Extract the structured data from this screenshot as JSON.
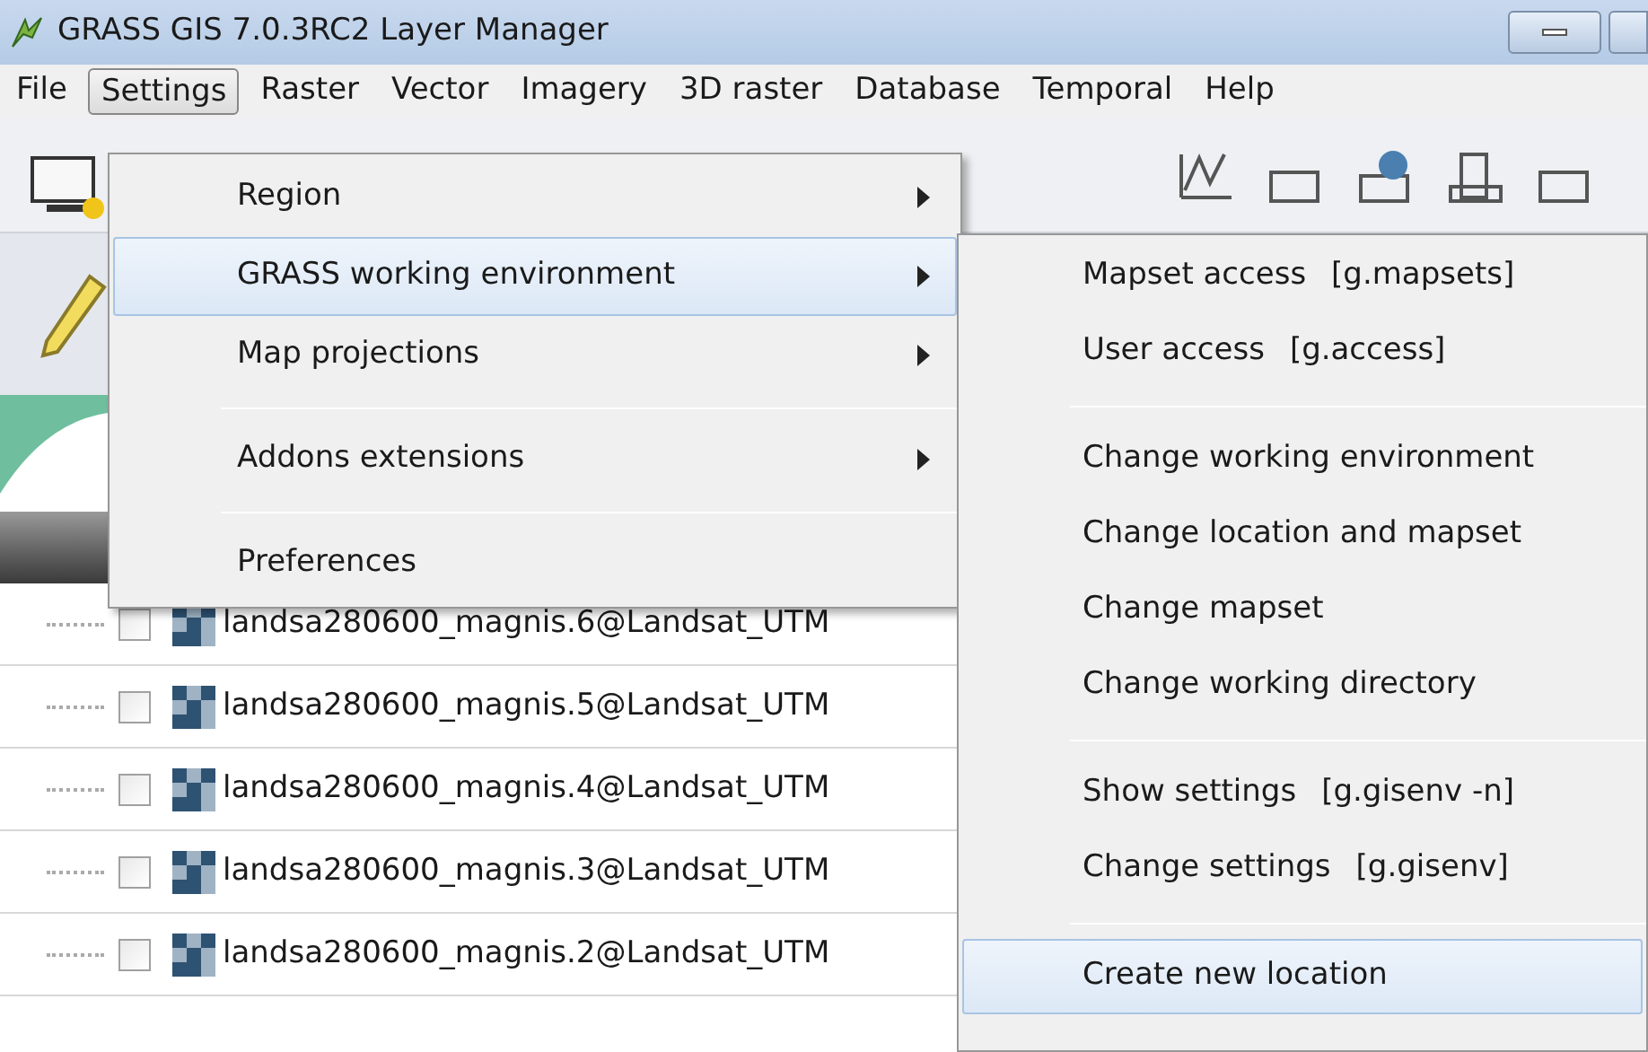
{
  "window": {
    "title": "GRASS GIS 7.0.3RC2 Layer Manager"
  },
  "menubar": [
    {
      "label": "File",
      "selected": false
    },
    {
      "label": "Settings",
      "selected": true
    },
    {
      "label": "Raster",
      "selected": false
    },
    {
      "label": "Vector",
      "selected": false
    },
    {
      "label": "Imagery",
      "selected": false
    },
    {
      "label": "3D raster",
      "selected": false
    },
    {
      "label": "Database",
      "selected": false
    },
    {
      "label": "Temporal",
      "selected": false
    },
    {
      "label": "Help",
      "selected": false
    }
  ],
  "settings_menu": [
    {
      "kind": "item",
      "label": "Region",
      "submenu": true,
      "selected": false
    },
    {
      "kind": "item",
      "label": "GRASS working environment",
      "submenu": true,
      "selected": true
    },
    {
      "kind": "item",
      "label": "Map projections",
      "submenu": true,
      "selected": false
    },
    {
      "kind": "separator"
    },
    {
      "kind": "item",
      "label": "Addons extensions",
      "submenu": true,
      "selected": false
    },
    {
      "kind": "separator"
    },
    {
      "kind": "item",
      "label": "Preferences",
      "submenu": false,
      "selected": false
    }
  ],
  "submenu": [
    {
      "kind": "item",
      "label": "Mapset access",
      "command": "[g.mapsets]",
      "selected": false
    },
    {
      "kind": "item",
      "label": "User access",
      "command": "[g.access]",
      "selected": false
    },
    {
      "kind": "separator"
    },
    {
      "kind": "item",
      "label": "Change working environment",
      "selected": false
    },
    {
      "kind": "item",
      "label": "Change location and mapset",
      "selected": false
    },
    {
      "kind": "item",
      "label": "Change mapset",
      "selected": false
    },
    {
      "kind": "item",
      "label": "Change working directory",
      "selected": false
    },
    {
      "kind": "separator"
    },
    {
      "kind": "item",
      "label": "Show settings",
      "command": "[g.gisenv -n]",
      "selected": false
    },
    {
      "kind": "item",
      "label": "Change settings",
      "command": "[g.gisenv]",
      "selected": false
    },
    {
      "kind": "separator"
    },
    {
      "kind": "item",
      "label": "Create new location",
      "selected": true
    }
  ],
  "layers": [
    {
      "name": "landsa280600_magnis.6@Landsat_UTM",
      "checked": false
    },
    {
      "name": "landsa280600_magnis.5@Landsat_UTM",
      "checked": false
    },
    {
      "name": "landsa280600_magnis.4@Landsat_UTM",
      "checked": false
    },
    {
      "name": "landsa280600_magnis.3@Landsat_UTM",
      "checked": false
    },
    {
      "name": "landsa280600_magnis.2@Landsat_UTM",
      "checked": false
    }
  ]
}
